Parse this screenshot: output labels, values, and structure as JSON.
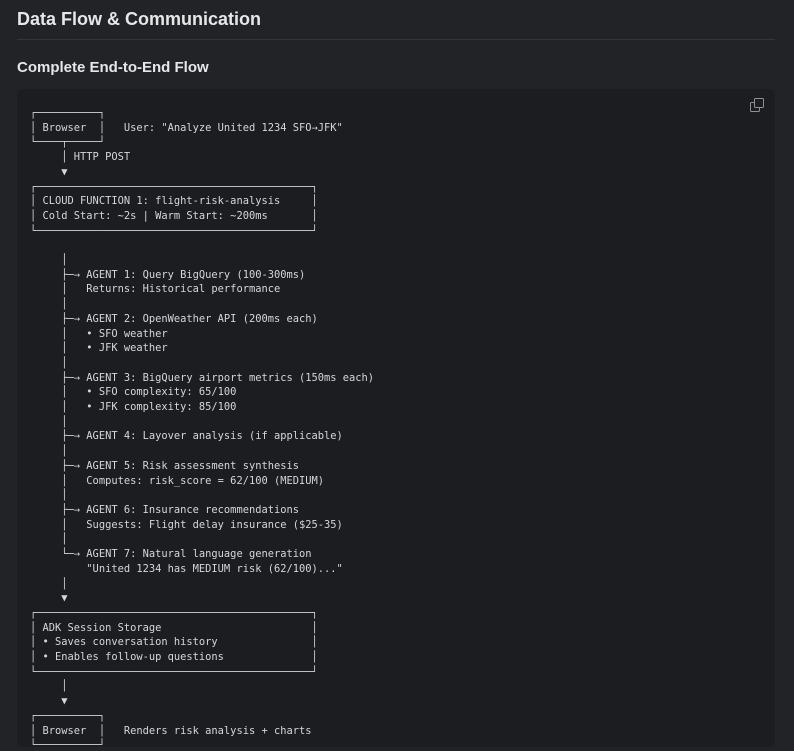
{
  "heading": "Data Flow & Communication",
  "subheading": "Complete End-to-End Flow",
  "copy_icon": "copy-icon",
  "diagram_lines": [
    "┌──────────┐",
    "│ Browser  │   User: \"Analyze United 1234 SFO→JFK\"",
    "└────┬─────┘",
    "     │ HTTP POST",
    "     ▼",
    "┌────────────────────────────────────────────┐",
    "│ CLOUD FUNCTION 1: flight-risk-analysis     │",
    "│ Cold Start: ~2s | Warm Start: ~200ms       │",
    "└────────────────────────────────────────────┘",
    "",
    "     │",
    "     ├─→ AGENT 1: Query BigQuery (100-300ms)",
    "     │   Returns: Historical performance",
    "     │",
    "     ├─→ AGENT 2: OpenWeather API (200ms each)",
    "     │   • SFO weather",
    "     │   • JFK weather",
    "     │",
    "     ├─→ AGENT 3: BigQuery airport metrics (150ms each)",
    "     │   • SFO complexity: 65/100",
    "     │   • JFK complexity: 85/100",
    "     │",
    "     ├─→ AGENT 4: Layover analysis (if applicable)",
    "     │",
    "     ├─→ AGENT 5: Risk assessment synthesis",
    "     │   Computes: risk_score = 62/100 (MEDIUM)",
    "     │",
    "     ├─→ AGENT 6: Insurance recommendations",
    "     │   Suggests: Flight delay insurance ($25-35)",
    "     │",
    "     └─→ AGENT 7: Natural language generation",
    "         \"United 1234 has MEDIUM risk (62/100)...\"",
    "     │",
    "     ▼",
    "┌────────────────────────────────────────────┐",
    "│ ADK Session Storage                        │",
    "│ • Saves conversation history               │",
    "│ • Enables follow-up questions              │",
    "└────────────────────────────────────────────┘",
    "     │",
    "     ▼",
    "┌──────────┐",
    "│ Browser  │   Renders risk analysis + charts",
    "└──────────┘"
  ]
}
